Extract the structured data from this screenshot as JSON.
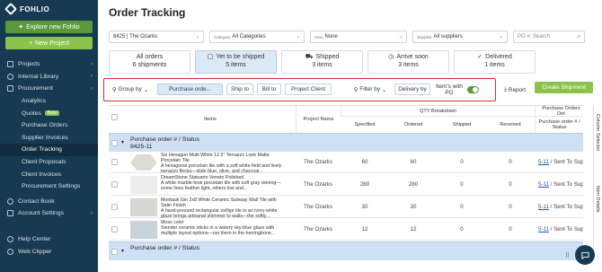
{
  "brand": {
    "logo_text": "FOHLIO"
  },
  "sidebar": {
    "explore_label": "Explore new Fohlio",
    "new_project_label": "New Project",
    "items": [
      {
        "label": "Projects",
        "icon": "folder-icon",
        "chevron": true
      },
      {
        "label": "Internal Library",
        "icon": "book-icon",
        "chevron": true
      },
      {
        "label": "Procurement",
        "icon": "cart-icon",
        "chevron": true
      },
      {
        "label": "Analytics",
        "sub": true
      },
      {
        "label": "Quotes",
        "sub": true,
        "badge": "Beta"
      },
      {
        "label": "Purchase Orders",
        "sub": true
      },
      {
        "label": "Supplier Invoices",
        "sub": true
      },
      {
        "label": "Order Tracking",
        "sub": true,
        "active": true
      },
      {
        "label": "Client Proposals",
        "sub": true
      },
      {
        "label": "Client Invoices",
        "sub": true
      },
      {
        "label": "Procurement Settings",
        "sub": true
      },
      {
        "label": "Contact Book",
        "icon": "contacts-icon"
      },
      {
        "label": "Account Settings",
        "icon": "gear-icon",
        "chevron": true
      }
    ],
    "bottom": [
      {
        "label": "Help Center",
        "icon": "help-icon"
      },
      {
        "label": "Web Clipper",
        "icon": "clipper-icon"
      }
    ]
  },
  "page": {
    "title": "Order Tracking"
  },
  "filters": {
    "project": "8425 | The Ozarks",
    "category_label": "Category",
    "category": "All Categories",
    "area_label": "Area",
    "area": "None",
    "supplier_label": "Supplier",
    "supplier": "All suppliers",
    "po_placeholder": "PO #: Search"
  },
  "status_tabs": [
    {
      "title": "All orders",
      "count": "6 shipments",
      "icon": ""
    },
    {
      "title": "Yet to be shipped",
      "count": "5 items",
      "icon": "▢",
      "active": true
    },
    {
      "title": "Shipped",
      "count": "3 items",
      "icon": "⛟"
    },
    {
      "title": "Arrive soon",
      "count": "3 items",
      "icon": "◷"
    },
    {
      "title": "Delivered",
      "count": "1 items",
      "icon": "✓"
    }
  ],
  "toolbar": {
    "group_by": "Group by",
    "purchase_order": "Purchase orde...",
    "ship_to": "Ship to",
    "bill_to": "Bill to",
    "project_client": "Project Client",
    "filter_by": "Filter by",
    "delivery_by": "Delivery by",
    "items_with_po": "Item's with PO",
    "items_with_po_on": true,
    "report": "Report",
    "create_shipment": "Create Shipment"
  },
  "table": {
    "headers": {
      "items": "Items",
      "project_name": "Project Name",
      "qty_breakdown": "QTY Breakdown",
      "specified": "Specified",
      "ordered": "Ordered",
      "shipped": "Shipped",
      "received": "Received",
      "purchase_orders_det": "Purchase Orders Det",
      "po_status": "Purchase order # / Status"
    },
    "group": {
      "title": "Purchase order # / Status",
      "subtitle": "8425-11"
    },
    "rows": [
      {
        "title": "Six Hexagon Multi White 12.5\" Terrazzo Look Matte Porcelain Tile",
        "desc": "A hexagonal porcelain tile with a soft white field and lively terrazzo flecks—slate blue, olive, and charcoal...",
        "thumb": "hexagon-tile-thumbnail",
        "project": "The Ozarks",
        "specified": "60",
        "ordered": "60",
        "shipped": "0",
        "received": "0",
        "po": "5-11",
        "po_status": "/ Sent To Supp"
      },
      {
        "title": "DreamStone Statuario Veneto Polished",
        "desc": "A white marble-look porcelain tile with soft gray veining—some lines feather light, others low and...",
        "thumb": "marble-tile-thumbnail",
        "project": "The Ozarks",
        "specified": "280",
        "ordered": "280",
        "shipped": "0",
        "received": "0",
        "po": "5-11",
        "po_status": "/ Sent To Supp"
      },
      {
        "title": "Montauk Gin 2x8 White Ceramic Subway Wall Tile with Satin Finish",
        "desc": "A hand-pressed rectangular zellige tile in an ivory-white glaze brings artisanal shimmer to walls—the softly...",
        "thumb": "subway-tile-thumbnail",
        "project": "The Ozarks",
        "specified": "30",
        "ordered": "30",
        "shipped": "0",
        "received": "0",
        "po": "5-11",
        "po_status": "/ Sent To Supp"
      },
      {
        "title": "Moss color",
        "desc": "Slender ceramic sticks in a watery sky-blue glaze with multiple layout options—run them in the herringbone...",
        "thumb": "ceramic-stick-thumbnail",
        "project": "The Ozarks",
        "specified": "12",
        "ordered": "12",
        "shipped": "0",
        "received": "0",
        "po": "5-11",
        "po_status": "/ Sent To Supp"
      }
    ],
    "group2": {
      "title": "Purchase order # / Status"
    }
  },
  "side_tabs": {
    "column_selector": "Column Selector",
    "item_details": "Item Details"
  },
  "colors": {
    "sidebar": "#173a52",
    "accent_green": "#8bc34a",
    "active_tab": "#dceaf7",
    "highlight_red": "#e02a2a"
  }
}
